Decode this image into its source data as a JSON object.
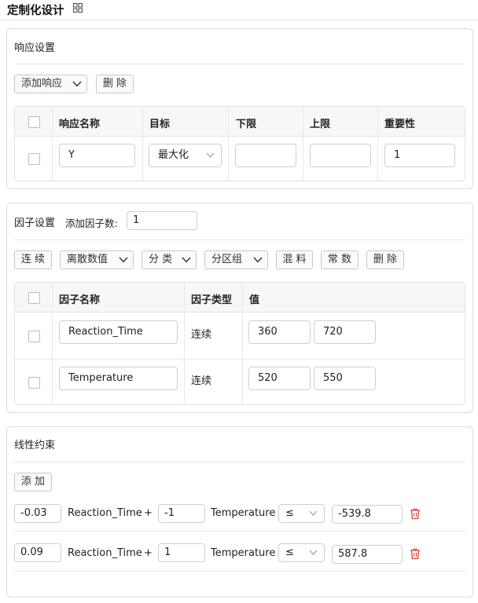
{
  "page": {
    "title": "定制化设计",
    "title_icon": "grid-icon"
  },
  "response": {
    "title": "响应设置",
    "add_button": "添加响应",
    "delete_button": "删 除",
    "columns": [
      "响应名称",
      "目标",
      "下限",
      "上限",
      "重要性"
    ],
    "rows": [
      {
        "name": "Y",
        "goal": "最大化",
        "lower": "",
        "upper": "",
        "importance": "1"
      }
    ]
  },
  "factor": {
    "title": "因子设置",
    "add_count_label": "添加因子数:",
    "add_count_value": "1",
    "buttons": {
      "continuous": "连 续",
      "discrete": "离散数值",
      "categorical": "分 类",
      "block": "分区组",
      "mixture": "混 料",
      "constant": "常 数",
      "delete": "删 除"
    },
    "columns": [
      "因子名称",
      "因子类型",
      "值"
    ],
    "rows": [
      {
        "name": "Reaction_Time",
        "type": "连续",
        "low": "360",
        "high": "720"
      },
      {
        "name": "Temperature",
        "type": "连续",
        "low": "520",
        "high": "550"
      }
    ]
  },
  "constraints": {
    "title": "线性约束",
    "add_button": "添 加",
    "rows": [
      {
        "coef1": "-0.03",
        "var1": "Reaction_Time",
        "plus": "+",
        "coef2": "-1",
        "var2": "Temperature",
        "op": "≤",
        "rhs": "-539.8"
      },
      {
        "coef1": "0.09",
        "var1": "Reaction_Time",
        "plus": "+",
        "coef2": "1",
        "var2": "Temperature",
        "op": "≤",
        "rhs": "587.8"
      }
    ]
  },
  "colors": {
    "border": "#dcdcdc",
    "header_bg": "#f7f7f7",
    "delete_red": "#e0453a"
  }
}
